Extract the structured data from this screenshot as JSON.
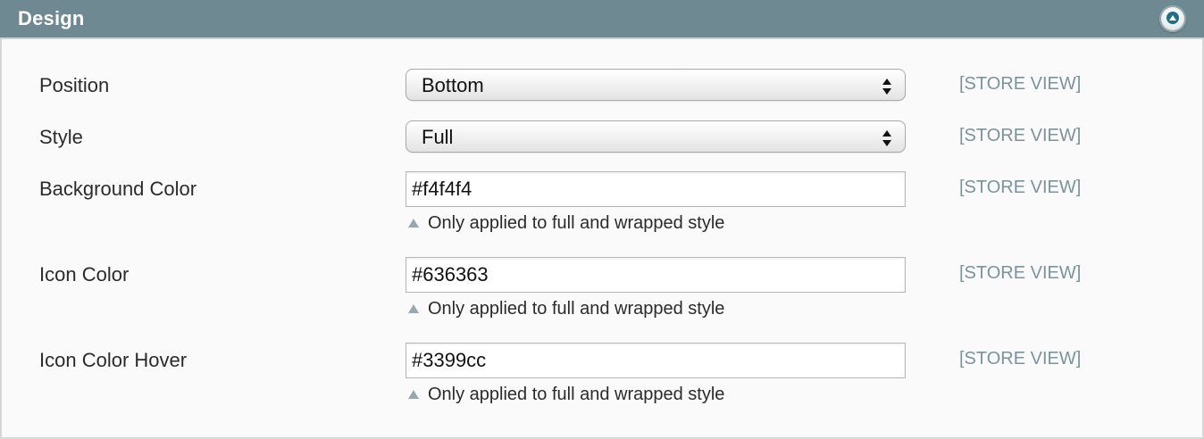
{
  "section": {
    "title": "Design"
  },
  "fields": {
    "position": {
      "label": "Position",
      "value": "Bottom",
      "scope": "[STORE VIEW]"
    },
    "style": {
      "label": "Style",
      "value": "Full",
      "scope": "[STORE VIEW]"
    },
    "background_color": {
      "label": "Background Color",
      "value": "#f4f4f4",
      "note": "Only applied to full and wrapped style",
      "scope": "[STORE VIEW]"
    },
    "icon_color": {
      "label": "Icon Color",
      "value": "#636363",
      "note": "Only applied to full and wrapped style",
      "scope": "[STORE VIEW]"
    },
    "icon_color_hover": {
      "label": "Icon Color Hover",
      "value": "#3399cc",
      "note": "Only applied to full and wrapped style",
      "scope": "[STORE VIEW]"
    }
  },
  "icons": {
    "collapse": "collapse-up-icon",
    "select_arrows": "updown-arrows-icon",
    "note": "note-triangle-icon"
  },
  "colors": {
    "header": "#6f8992",
    "scope_text": "#7d929a",
    "panel_bg": "#fafafa"
  }
}
